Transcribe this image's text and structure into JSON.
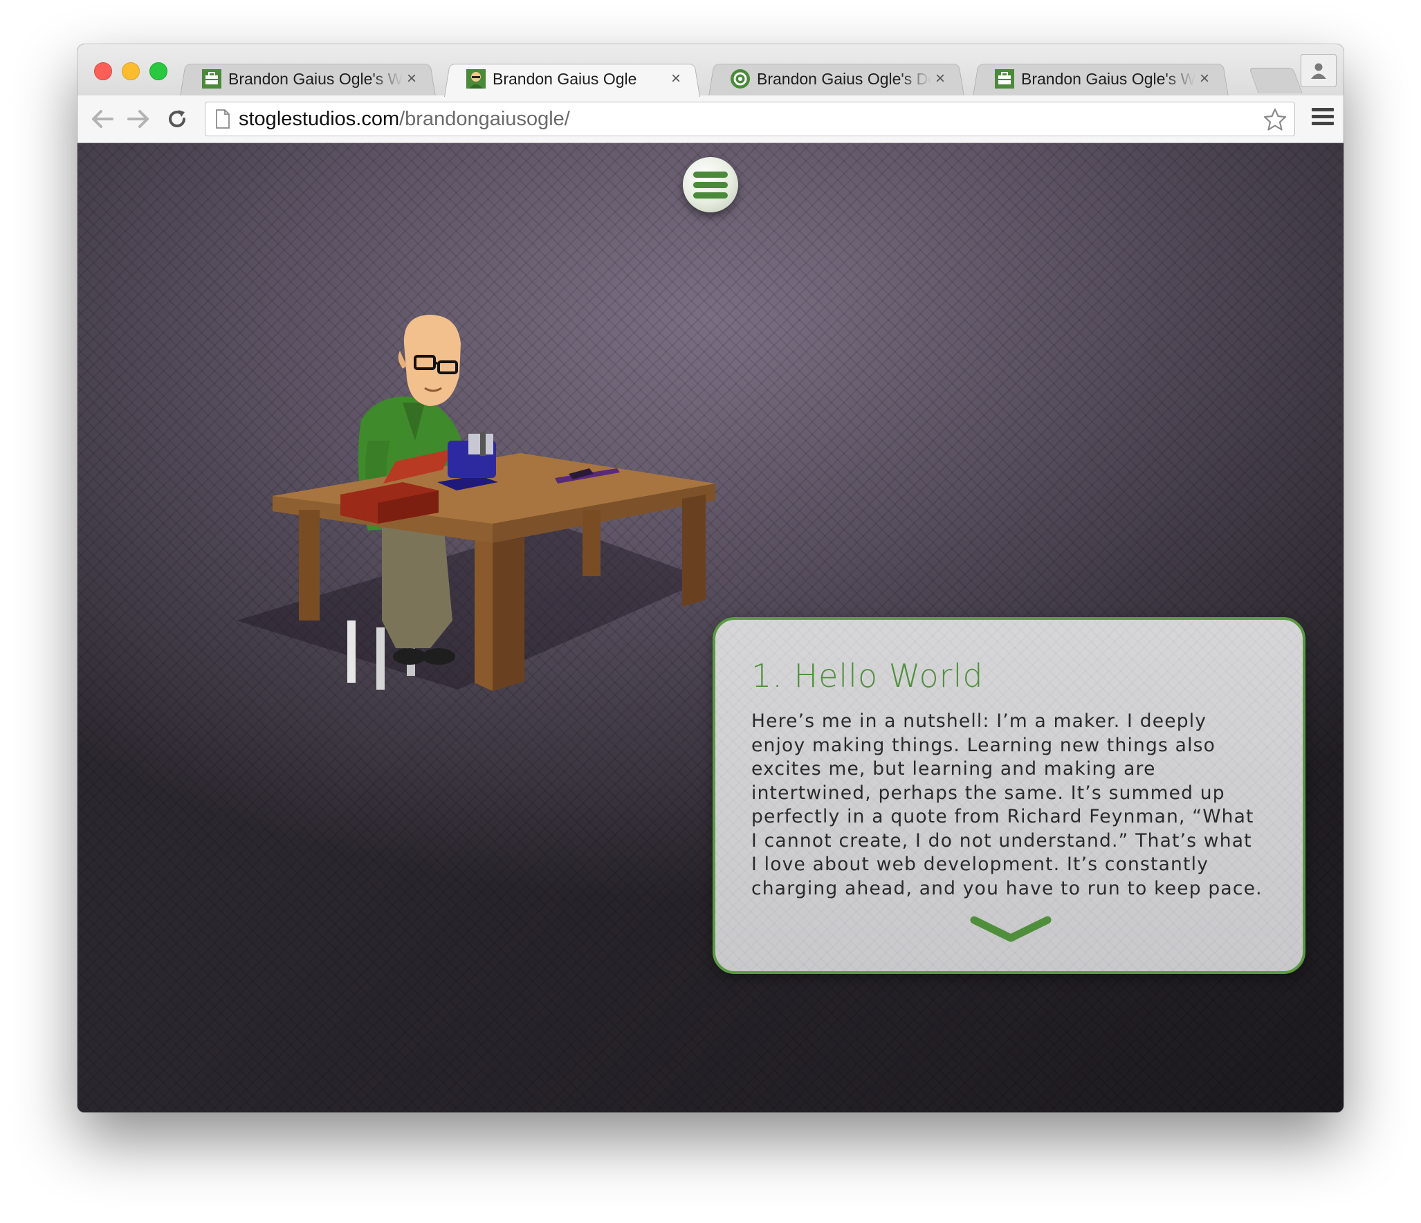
{
  "browser": {
    "tabs": [
      {
        "title": "Brandon Gaius Ogle's Web",
        "favicon": "briefcase-icon",
        "active": false
      },
      {
        "title": "Brandon Gaius Ogle",
        "favicon": "avatar-icon",
        "active": true
      },
      {
        "title": "Brandon Gaius Ogle's Dem",
        "favicon": "gear-badge-icon",
        "active": false
      },
      {
        "title": "Brandon Gaius Ogle's Web",
        "favicon": "briefcase-icon",
        "active": false
      }
    ],
    "close_symbol": "×",
    "url_host": "stoglestudios.com",
    "url_path": "/brandongaiusogle/"
  },
  "page": {
    "menu_button": "hamburger-icon",
    "illustration": "man-at-workbench-illustration",
    "card": {
      "title": "1. Hello World",
      "body": "Here’s me in a nutshell: I’m a maker. I deeply enjoy making things. Learning new things also excites me, but learning and making are intertwined, perhaps the same. It’s summed up perfectly in a quote from Richard Feynman, “What I cannot create, I do not understand.” That’s what I love about web development. It’s constantly charging ahead, and you have to run to keep pace.",
      "next_icon": "chevron-down-icon"
    }
  },
  "colors": {
    "accent_green": "#5a9a44",
    "title_green": "#4f8f3b",
    "background_purple": "#5c5263"
  }
}
